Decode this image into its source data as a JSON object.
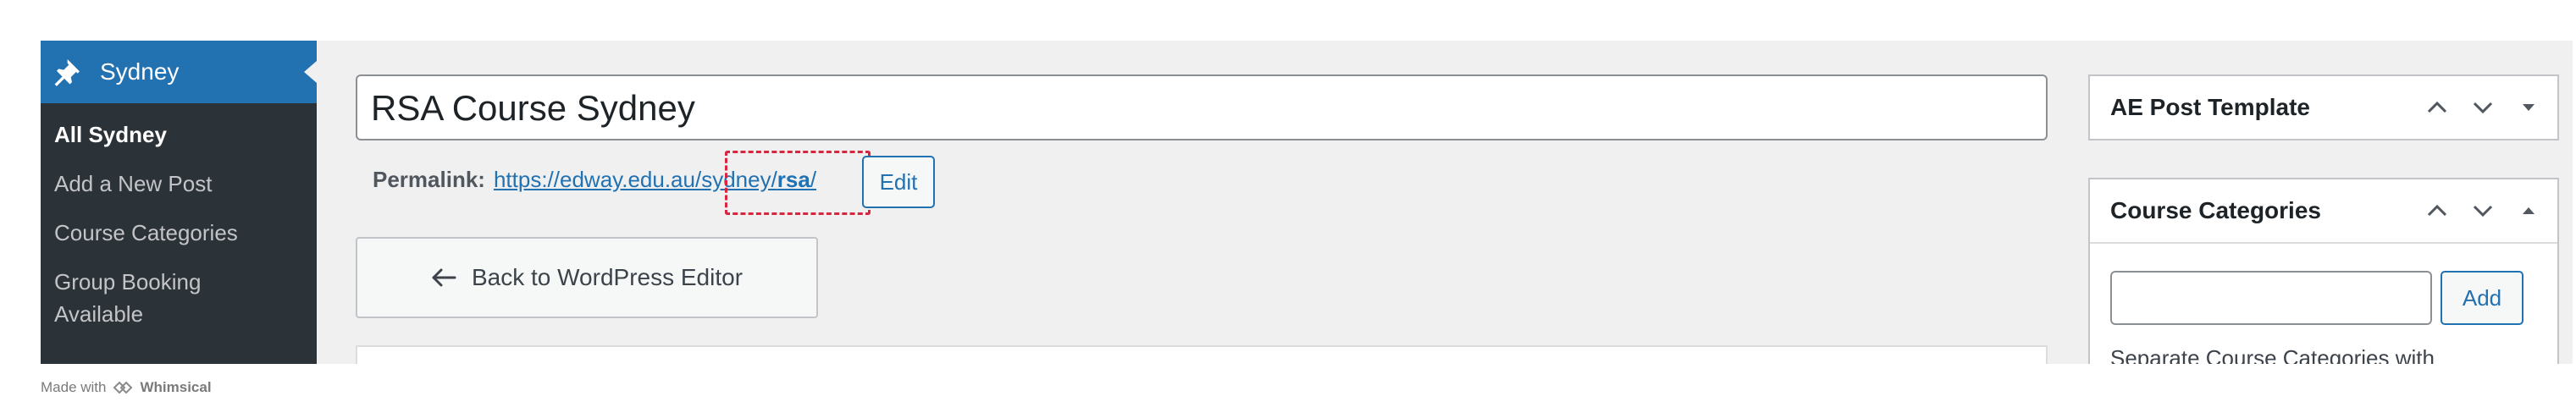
{
  "sidebar": {
    "menu_title": "Sydney",
    "pin_icon": "pin-icon",
    "items": [
      {
        "label": "All Sydney",
        "current": true
      },
      {
        "label": "Add a New Post",
        "current": false
      },
      {
        "label": "Course Categories",
        "current": false
      },
      {
        "label": "Group Booking\nAvailable",
        "current": false
      }
    ]
  },
  "editor": {
    "post_title": "RSA Course Sydney",
    "permalink_label": "Permalink:",
    "permalink_base": "https://edway.edu.au/sydney/",
    "permalink_slug": "rsa",
    "permalink_trailing": "/",
    "edit_label": "Edit",
    "back_label": "Back to WordPress Editor"
  },
  "meta_boxes": {
    "ae_post_template": {
      "title": "AE Post Template"
    },
    "course_categories": {
      "title": "Course Categories",
      "add_label": "Add",
      "input_value": "",
      "help_text": "Separate Course Categories with"
    }
  },
  "footer": {
    "made_with": "Made with",
    "brand": "Whimsical"
  },
  "colors": {
    "accent": "#2271b1",
    "sidebar_bg": "#2c3338",
    "highlight": "#d7263d"
  }
}
